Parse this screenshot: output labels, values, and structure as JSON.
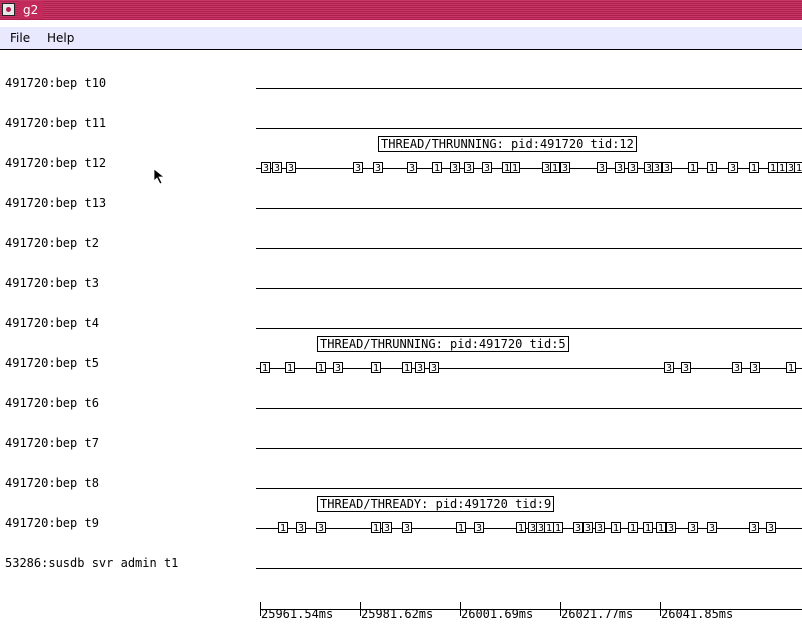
{
  "window": {
    "title": "g2"
  },
  "menu": {
    "file": "File",
    "help": "Help"
  },
  "rows": [
    {
      "label": "491720:bep t10",
      "events": []
    },
    {
      "label": "491720:bep t11",
      "events": []
    },
    {
      "label": "491720:bep t12",
      "tag": "THREAD/THRUNNING: pid:491720 tid:12",
      "events": [
        "3",
        "3",
        "3",
        "3",
        "3",
        "3",
        "1",
        "3",
        "3",
        "3",
        "1",
        "1",
        "3",
        "1",
        "3",
        "3",
        "3",
        "3",
        "3",
        "3",
        "3",
        "1",
        "1",
        "3",
        "1",
        "1",
        "1",
        "3",
        "1"
      ]
    },
    {
      "label": "491720:bep t13",
      "events": []
    },
    {
      "label": "491720:bep t2",
      "events": []
    },
    {
      "label": "491720:bep t3",
      "events": []
    },
    {
      "label": "491720:bep t4",
      "events": []
    },
    {
      "label": "491720:bep t5",
      "tag": "THREAD/THRUNNING: pid:491720 tid:5",
      "events": [
        "1",
        "1",
        "1",
        "3",
        "1",
        "1",
        "3",
        "3",
        "3",
        "3",
        "3",
        "3",
        "1"
      ]
    },
    {
      "label": "491720:bep t6",
      "events": []
    },
    {
      "label": "491720:bep t7",
      "events": []
    },
    {
      "label": "491720:bep t8",
      "events": []
    },
    {
      "label": "491720:bep t9",
      "tag": "THREAD/THREADY: pid:491720 tid:9",
      "events": [
        "1",
        "3",
        "3",
        "1",
        "3",
        "3",
        "1",
        "3",
        "1",
        "3",
        "3",
        "1",
        "1",
        "3",
        "3",
        "3",
        "1",
        "1",
        "1",
        "1",
        "3",
        "3",
        "3",
        "3",
        "3"
      ]
    },
    {
      "label": "53286:susdb svr admin t1",
      "events": []
    }
  ],
  "axis": {
    "ticks": [
      "25961.54ms",
      "25981.62ms",
      "26001.69ms",
      "26021.77ms",
      "26041.85ms"
    ]
  }
}
